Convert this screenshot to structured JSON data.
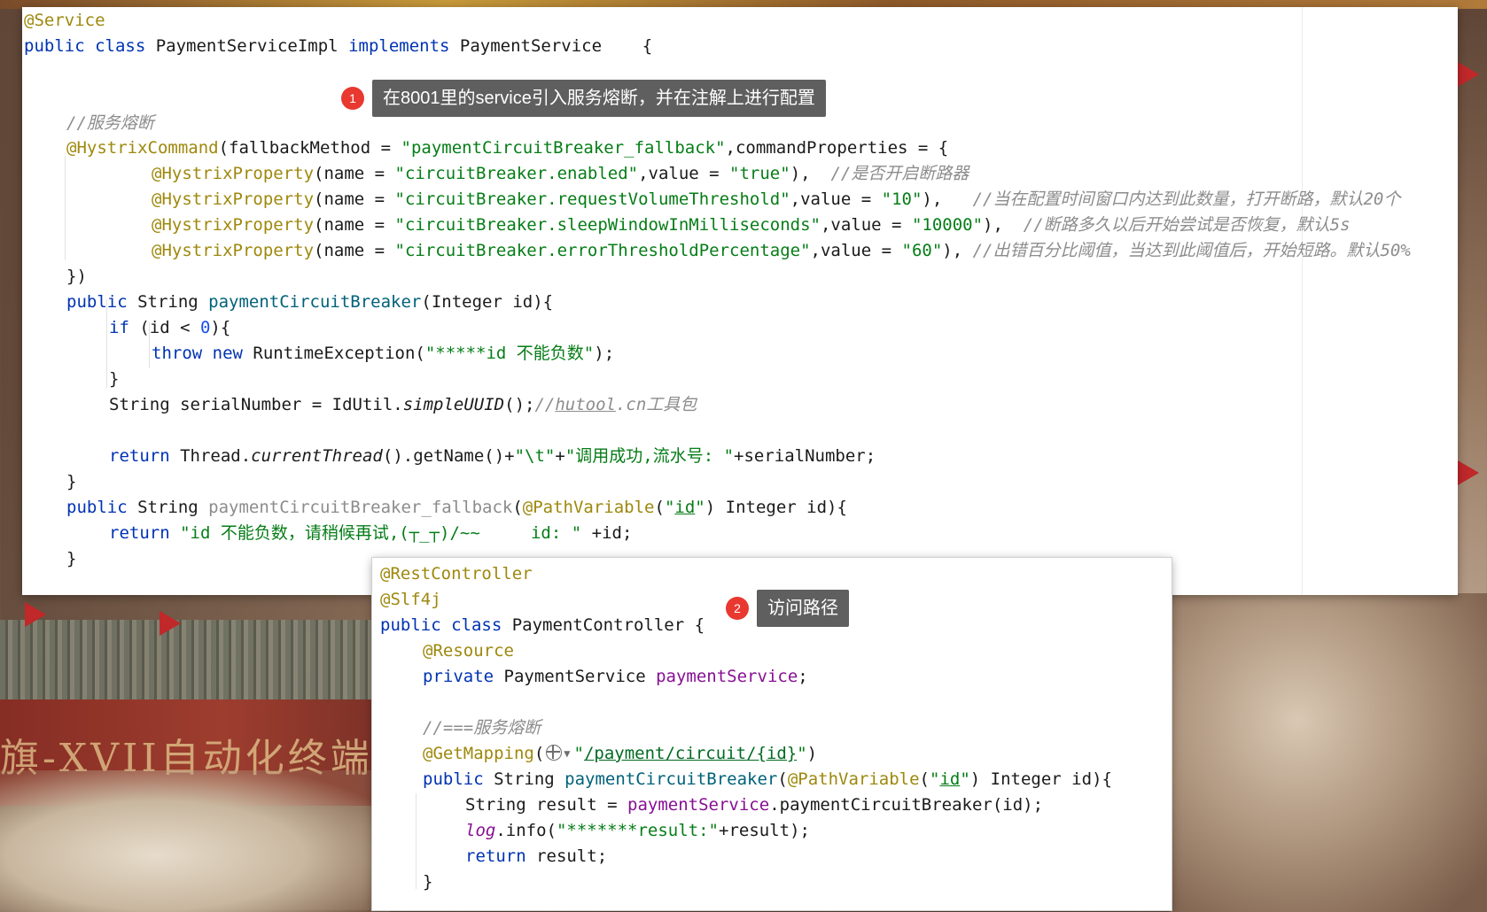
{
  "background": {
    "banner_text": "旗-XVII自动化终端为人民服"
  },
  "callouts": [
    {
      "number": "1",
      "text": "在8001里的service引入服务熔断，并在注解上进行配置"
    },
    {
      "number": "2",
      "text": "访问路径"
    }
  ],
  "service_code": {
    "l1_ann": "@Service",
    "l2_kw": "public class ",
    "l2_name": "PaymentServiceImpl ",
    "l2_impl": "implements ",
    "l2_iface": "PaymentService    {",
    "l5_cmt": "//服务熔断",
    "l6_ann": "@HystrixCommand",
    "l6_a": "(fallbackMethod = ",
    "l6_str": "\"paymentCircuitBreaker_fallback\"",
    "l6_b": ",commandProperties = {",
    "p1_ann": "@HystrixProperty",
    "p1_a": "(name = ",
    "p1_str": "\"circuitBreaker.enabled\"",
    "p1_b": ",value = ",
    "p1_val": "\"true\"",
    "p1_c": "),  ",
    "p1_cmt": "//是否开启断路器",
    "p2_ann": "@HystrixProperty",
    "p2_a": "(name = ",
    "p2_str": "\"circuitBreaker.requestVolumeThreshold\"",
    "p2_b": ",value = ",
    "p2_val": "\"10\"",
    "p2_c": "),   ",
    "p2_cmt": "//当在配置时间窗口内达到此数量，打开断路，默认20个",
    "p3_ann": "@HystrixProperty",
    "p3_a": "(name = ",
    "p3_str": "\"circuitBreaker.sleepWindowInMilliseconds\"",
    "p3_b": ",value = ",
    "p3_val": "\"10000\"",
    "p3_c": "),  ",
    "p3_cmt": "//断路多久以后开始尝试是否恢复，默认5s",
    "p4_ann": "@HystrixProperty",
    "p4_a": "(name = ",
    "p4_str": "\"circuitBreaker.errorThresholdPercentage\"",
    "p4_b": ",value = ",
    "p4_val": "\"60\"",
    "p4_c": "), ",
    "p4_cmt": "//出错百分比阈值，当达到此阈值后，开始短路。默认50%",
    "l11": "})",
    "m1_kw": "public ",
    "m1_type": "String ",
    "m1_name": "paymentCircuitBreaker",
    "m1_args": "(Integer id){",
    "if_kw": "if ",
    "if_a": "(id < ",
    "if_num": "0",
    "if_b": "){",
    "throw_kw": "throw new ",
    "throw_a": "RuntimeException(",
    "throw_str": "\"*****id 不能负数\"",
    "throw_b": ");",
    "close1": "}",
    "ser_a": "String serialNumber = IdUtil.",
    "ser_m": "simpleUUID",
    "ser_b": "();",
    "ser_cmt_a": "//",
    "ser_cmt_u": "hutool",
    "ser_cmt_b": ".cn工具包",
    "ret_kw": "return ",
    "ret_a": "Thread.",
    "ret_m": "currentThread",
    "ret_b": "().getName()+",
    "ret_s1": "\"\\t\"",
    "ret_c": "+",
    "ret_s2": "\"调用成功,流水号: \"",
    "ret_d": "+serialNumber;",
    "close2": "}",
    "fb_kw": "public ",
    "fb_type": "String ",
    "fb_name": "paymentCircuitBreaker_fallback",
    "fb_a": "(",
    "fb_ann": "@PathVariable",
    "fb_b": "(",
    "fb_str_q1": "\"",
    "fb_str_id": "id",
    "fb_str_q2": "\"",
    "fb_c": ") Integer id){",
    "fbr_kw": "return ",
    "fbr_str": "\"id 不能负数，请稍候再试,(┬_┬)/~~     id: \"",
    "fbr_b": " +id;",
    "close3": "}"
  },
  "controller_code": {
    "c1": "@RestController",
    "c2": "@Slf4j",
    "c3_kw": "public class ",
    "c3_b": "PaymentController {",
    "c4": "@Resource",
    "c5_kw": "private ",
    "c5_type": "PaymentService ",
    "c5_fld": "paymentService",
    "c5_b": ";",
    "c7": "//===服务熔断",
    "c8_ann": "@GetMapping",
    "c8_a": "(",
    "c8_q1": "\"",
    "c8_path": "/payment/circuit/{id}",
    "c8_q2": "\"",
    "c8_b": ")",
    "c9_kw": "public ",
    "c9_type": "String ",
    "c9_name": "paymentCircuitBreaker",
    "c9_a": "(",
    "c9_ann": "@PathVariable",
    "c9_b": "(",
    "c9_q1": "\"",
    "c9_id": "id",
    "c9_q2": "\"",
    "c9_c": ") Integer id){",
    "c10_a": "String result = ",
    "c10_fld": "paymentService",
    "c10_b": ".paymentCircuitBreaker(id);",
    "c11_log": "log",
    "c11_a": ".info(",
    "c11_str": "\"*******result:\"",
    "c11_b": "+result);",
    "c12_kw": "return ",
    "c12_b": "result;",
    "c13": "}"
  }
}
